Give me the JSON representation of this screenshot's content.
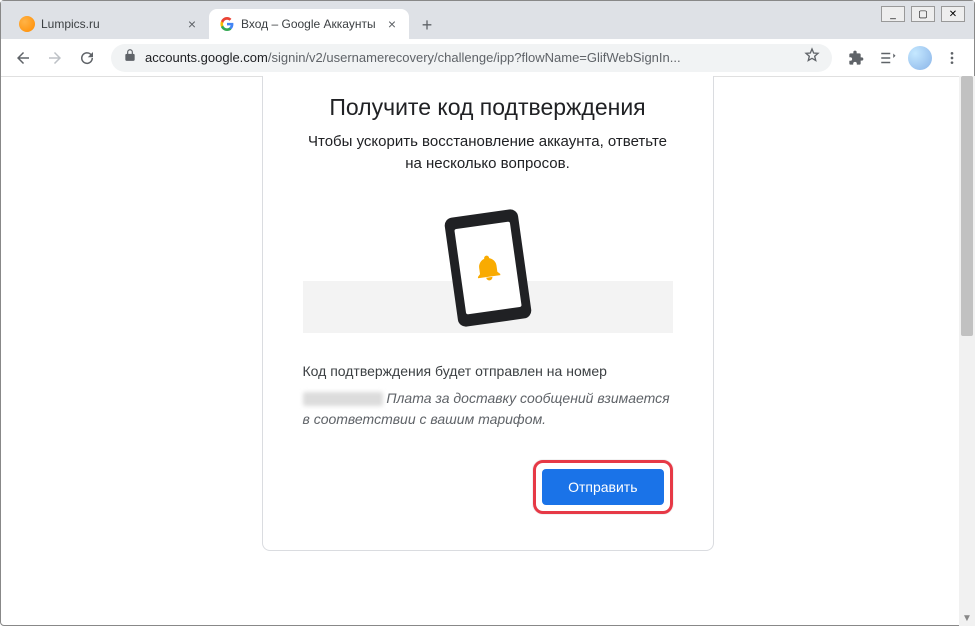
{
  "window": {
    "min": "_",
    "max": "▢",
    "close": "✕"
  },
  "tabs": [
    {
      "title": "Lumpics.ru",
      "active": false
    },
    {
      "title": "Вход – Google Аккаунты",
      "active": true
    }
  ],
  "toolbar": {
    "url_domain": "accounts.google.com",
    "url_path": "/signin/v2/usernamerecovery/challenge/ipp?flowName=GlifWebSignIn..."
  },
  "card": {
    "title": "Получите код подтверждения",
    "subtitle": "Чтобы ускорить восстановление аккаунта, ответьте на несколько вопросов.",
    "desc_line1": "Код подтверждения будет отправлен на номер",
    "desc_fee": "Плата за доставку сообщений взимается в соответствии с вашим тарифом.",
    "send_label": "Отправить"
  }
}
